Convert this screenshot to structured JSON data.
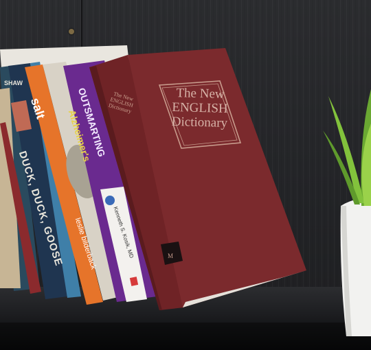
{
  "scene": {
    "description_labels": [
      "bookshelf",
      "books",
      "plant"
    ]
  },
  "books": {
    "dictionary_cover": {
      "line1": "The New",
      "line2": "ENGLISH",
      "line3": "Dictionary"
    },
    "dictionary_spine": {
      "line1": "The New",
      "line2": "ENGLISH",
      "line3": "Dictionary"
    },
    "duck_spine": "DUCK, DUCK, GOOSE",
    "salt_spine": "salt",
    "outsmarting_spine": "OUTSMARTING",
    "alzheimers_spine": "Alzheimer's",
    "leslie_spine": "leslie bilderback",
    "kenneth_spine": "Kenneth S. Kosik, MD",
    "shaw_spine": "SHAW"
  },
  "colors": {
    "dictionary": "#7b2a2d",
    "wall": "#26272a",
    "shelf": "#1b1c1f",
    "plant_pot": "#f2f2f0",
    "plant_leaf": "#7fbf3a"
  }
}
